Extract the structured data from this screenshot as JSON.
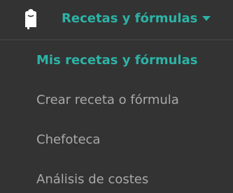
{
  "header": {
    "icon": "chef-hat-icon",
    "menu_title": "Recetas y fórmulas",
    "accent_color": "#2db3a6"
  },
  "dropdown": {
    "items": [
      {
        "label": "Mis recetas y fórmulas",
        "active": true
      },
      {
        "label": "Crear receta o fórmula",
        "active": false
      },
      {
        "label": "Chefoteca",
        "active": false
      },
      {
        "label": "Análisis de costes",
        "active": false
      }
    ]
  }
}
